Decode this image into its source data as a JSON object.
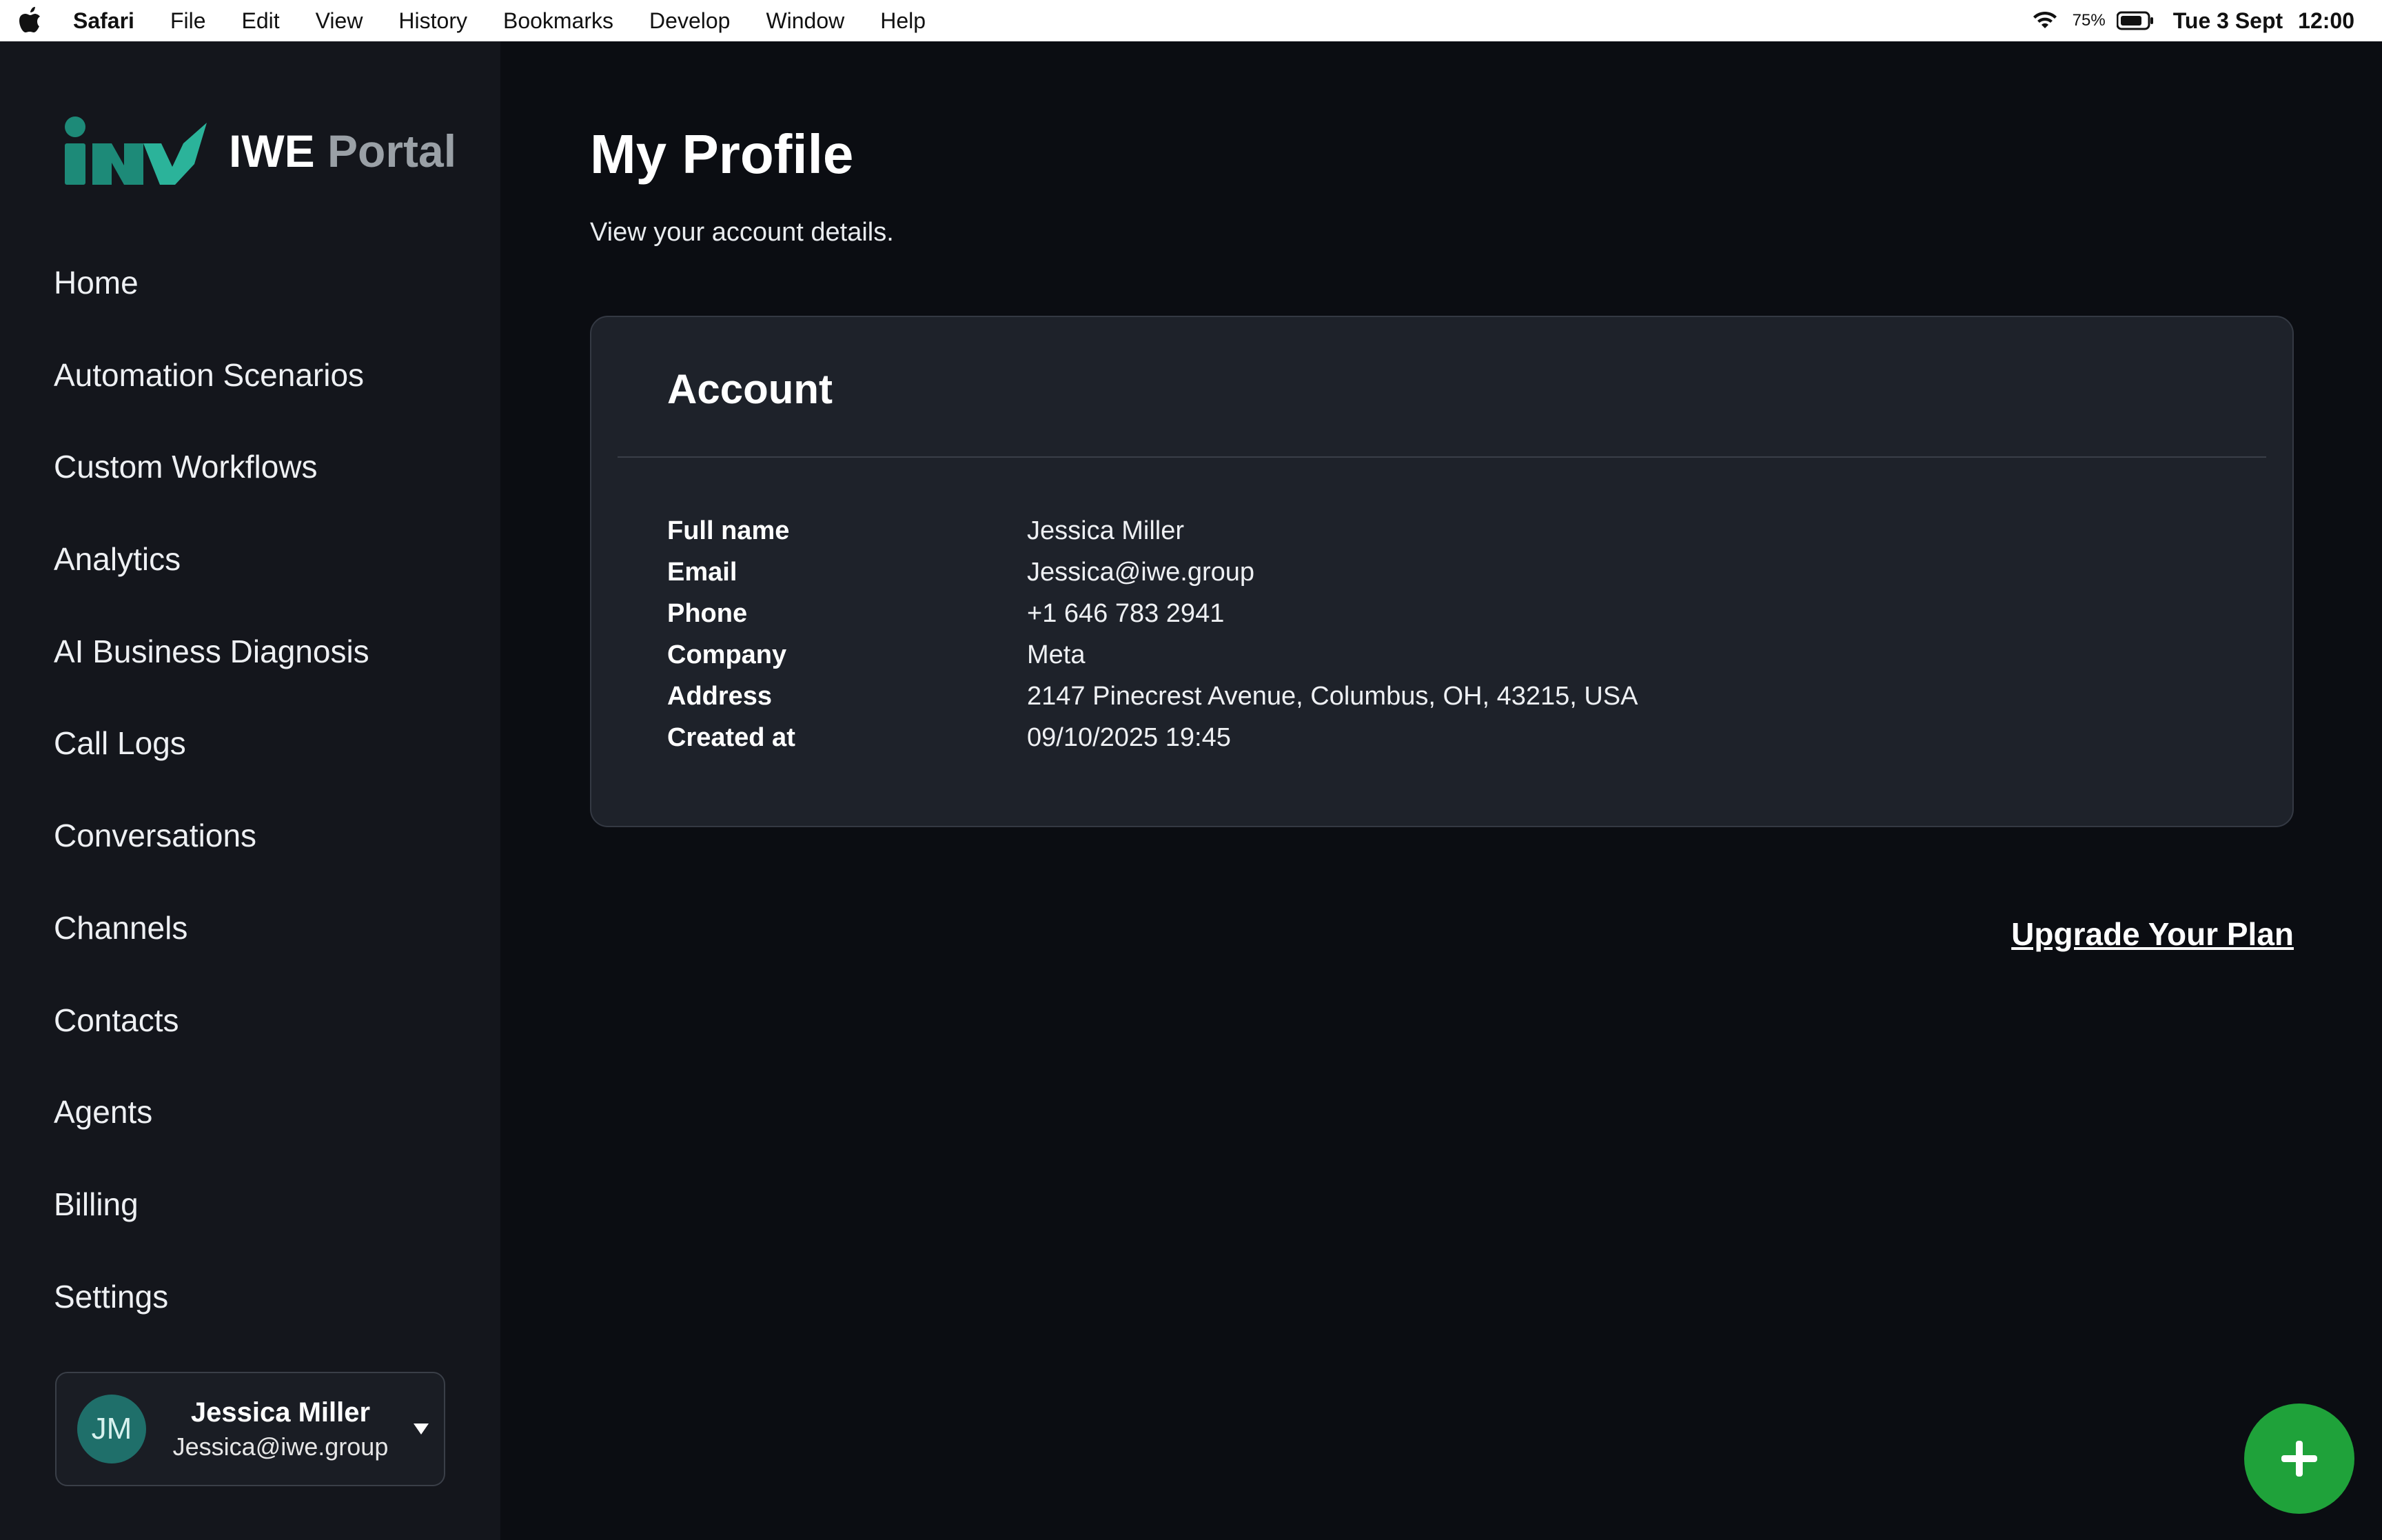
{
  "menubar": {
    "app": "Safari",
    "items": [
      "File",
      "Edit",
      "View",
      "History",
      "Bookmarks",
      "Develop",
      "Window",
      "Help"
    ],
    "battery_pct": "75%",
    "date": "Tue 3 Sept",
    "time": "12:00"
  },
  "brand": {
    "name": "IWE",
    "sub": "Portal",
    "logo_color": "#1d8a78"
  },
  "nav": {
    "items": [
      "Home",
      "Automation Scenarios",
      "Custom Workflows",
      "Analytics",
      "AI Business Diagnosis",
      "Call Logs",
      "Conversations",
      "Channels",
      "Contacts",
      "Agents",
      "Billing",
      "Settings"
    ]
  },
  "user": {
    "initials": "JM",
    "name": "Jessica Miller",
    "email": "Jessica@iwe.group"
  },
  "page": {
    "title": "My Profile",
    "subtitle": "View your account details."
  },
  "account": {
    "title": "Account",
    "rows": [
      {
        "label": "Full name",
        "value": "Jessica Miller"
      },
      {
        "label": "Email",
        "value": "Jessica@iwe.group"
      },
      {
        "label": "Phone",
        "value": "+1 646 783 2941"
      },
      {
        "label": "Company",
        "value": "Meta"
      },
      {
        "label": "Address",
        "value": "2147 Pinecrest Avenue, Columbus, OH, 43215, USA"
      },
      {
        "label": "Created at",
        "value": "09/10/2025 19:45"
      }
    ]
  },
  "upgrade_label": "Upgrade Your Plan",
  "colors": {
    "accent_green": "#1fa23a",
    "avatar_teal": "#1f6f6a",
    "background": "#0b0d12"
  }
}
